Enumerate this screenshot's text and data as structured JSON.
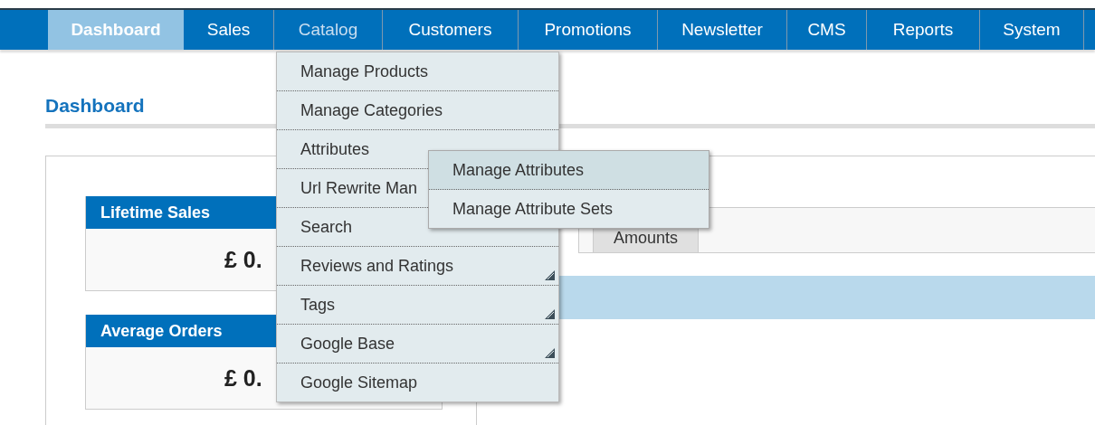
{
  "nav": {
    "items": [
      {
        "label": "Dashboard",
        "selected": true,
        "hovered": false
      },
      {
        "label": "Sales",
        "selected": false,
        "hovered": false
      },
      {
        "label": "Catalog",
        "selected": false,
        "hovered": true
      },
      {
        "label": "Customers",
        "selected": false,
        "hovered": false
      },
      {
        "label": "Promotions",
        "selected": false,
        "hovered": false
      },
      {
        "label": "Newsletter",
        "selected": false,
        "hovered": false
      },
      {
        "label": "CMS",
        "selected": false,
        "hovered": false
      },
      {
        "label": "Reports",
        "selected": false,
        "hovered": false
      },
      {
        "label": "System",
        "selected": false,
        "hovered": false
      }
    ]
  },
  "page_title": "Dashboard",
  "stats": [
    {
      "title": "Lifetime Sales",
      "value": "£ 0."
    },
    {
      "title": "Average Orders",
      "value": "£ 0."
    }
  ],
  "chart_tabs": [
    {
      "label": "Amounts"
    }
  ],
  "catalog_menu": {
    "items": [
      {
        "label": "Manage Products",
        "kind": "link"
      },
      {
        "label": "Manage Categories",
        "kind": "link"
      },
      {
        "label": "Attributes",
        "kind": "parent",
        "children": [
          {
            "label": "Manage Attributes",
            "selected": true
          },
          {
            "label": "Manage Attribute Sets",
            "selected": false
          }
        ]
      },
      {
        "label": "Url Rewrite Man",
        "kind": "link"
      },
      {
        "label": "Search",
        "kind": "link"
      },
      {
        "label": "Reviews and Ratings",
        "kind": "parent"
      },
      {
        "label": "Tags",
        "kind": "parent"
      },
      {
        "label": "Google Base",
        "kind": "parent"
      },
      {
        "label": "Google Sitemap",
        "kind": "link"
      }
    ]
  }
}
